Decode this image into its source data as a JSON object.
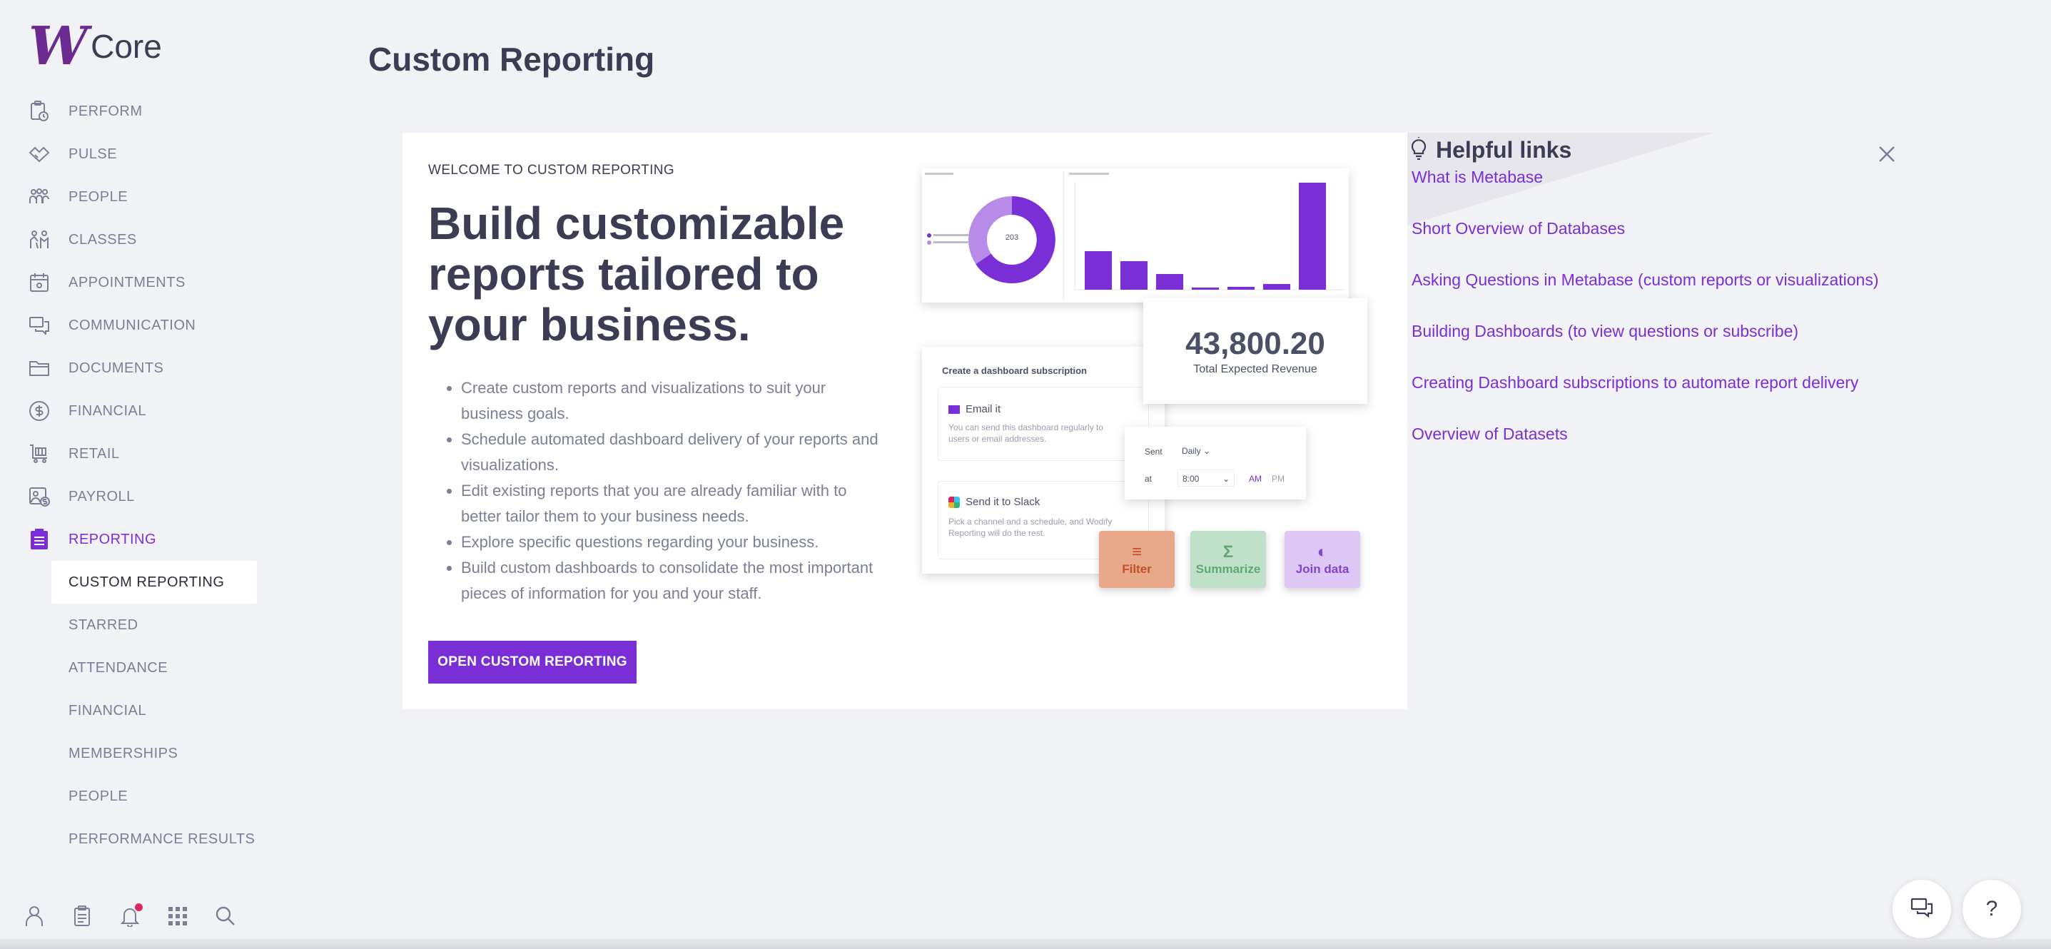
{
  "app": {
    "logo_mark": "W",
    "logo_text": "Core"
  },
  "sidebar": {
    "items": [
      {
        "label": "PERFORM",
        "icon": "clipboard-clock-icon"
      },
      {
        "label": "PULSE",
        "icon": "handshake-icon"
      },
      {
        "label": "PEOPLE",
        "icon": "people-icon"
      },
      {
        "label": "CLASSES",
        "icon": "classes-icon"
      },
      {
        "label": "APPOINTMENTS",
        "icon": "calendar-icon"
      },
      {
        "label": "COMMUNICATION",
        "icon": "chat-icon"
      },
      {
        "label": "DOCUMENTS",
        "icon": "folder-icon"
      },
      {
        "label": "FINANCIAL",
        "icon": "dollar-circle-icon"
      },
      {
        "label": "RETAIL",
        "icon": "cart-icon"
      },
      {
        "label": "PAYROLL",
        "icon": "payroll-icon"
      },
      {
        "label": "REPORTING",
        "icon": "report-icon",
        "active": true
      }
    ],
    "subitems": [
      {
        "label": "CUSTOM REPORTING",
        "active": true
      },
      {
        "label": "STARRED"
      },
      {
        "label": "ATTENDANCE"
      },
      {
        "label": "FINANCIAL"
      },
      {
        "label": "MEMBERSHIPS"
      },
      {
        "label": "PEOPLE"
      },
      {
        "label": "PERFORMANCE RESULTS"
      }
    ],
    "bottom_icons": [
      "user-icon",
      "clipboard-icon",
      "bell-icon",
      "apps-grid-icon",
      "search-icon"
    ]
  },
  "page": {
    "title": "Custom Reporting"
  },
  "card": {
    "eyebrow": "WELCOME TO CUSTOM REPORTING",
    "headline": "Build customizable reports tailored to your business.",
    "bullets": [
      "Create custom reports and visualizations to suit your business goals.",
      "Schedule automated dashboard delivery of your reports and visualizations.",
      "Edit existing reports that you are already familiar with to better tailor them to your business needs.",
      "Explore specific questions regarding your business.",
      "Build custom dashboards to consolidate the most important pieces of information for you and your staff."
    ],
    "cta": "OPEN CUSTOM REPORTING",
    "illustration": {
      "revenue_value": "43,800.20",
      "revenue_label": "Total Expected Revenue",
      "subscription_title": "Create a dashboard subscription",
      "email_title": "Email it",
      "email_desc": "You can send this dashboard regularly to users or email addresses.",
      "slack_title": "Send it to Slack",
      "slack_desc": "Pick a channel and a schedule, and Wodify Reporting will do the rest.",
      "sent_label": "Sent",
      "sent_value": "Daily",
      "at_label": "at",
      "at_value": "8:00",
      "am": "AM",
      "pm": "PM",
      "tiles": [
        "Filter",
        "Summarize",
        "Join data"
      ],
      "donut_center": "203"
    }
  },
  "help": {
    "title": "Helpful links",
    "links": [
      "What is Metabase",
      "Short Overview of Databases",
      "Asking Questions in Metabase (custom reports or visualizations)",
      "Building Dashboards (to view questions or subscribe)",
      "Creating Dashboard subscriptions to automate report delivery",
      "Overview of Datasets"
    ]
  },
  "colors": {
    "accent": "#7a2fd6",
    "logo": "#6b2a8f",
    "notification": "#e0245e"
  }
}
